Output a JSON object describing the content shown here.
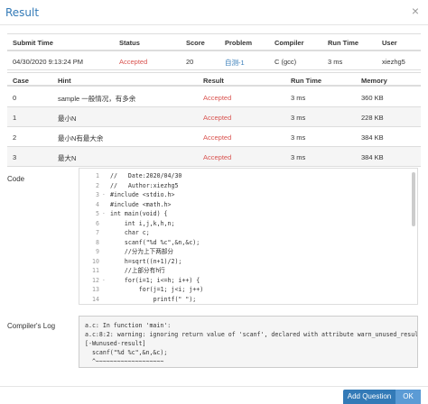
{
  "dialog": {
    "title": "Result",
    "close_glyph": "×"
  },
  "summary": {
    "headers": [
      "Submit Time",
      "Status",
      "Score",
      "Problem",
      "Compiler",
      "Run Time",
      "User"
    ],
    "row": {
      "submit_time": "04/30/2020 9:13:24 PM",
      "status": "Accepted",
      "score": "20",
      "problem": "自测-1",
      "compiler": "C (gcc)",
      "run_time": "3 ms",
      "user": "xiezhg5"
    }
  },
  "cases": {
    "headers": [
      "Case",
      "Hint",
      "Result",
      "Run Time",
      "Memory"
    ],
    "rows": [
      {
        "case": "0",
        "hint": "sample 一般情况，有多余",
        "result": "Accepted",
        "run_time": "3 ms",
        "memory": "360 KB"
      },
      {
        "case": "1",
        "hint": "最小N",
        "result": "Accepted",
        "run_time": "3 ms",
        "memory": "228 KB"
      },
      {
        "case": "2",
        "hint": "最小N有最大余",
        "result": "Accepted",
        "run_time": "3 ms",
        "memory": "384 KB"
      },
      {
        "case": "3",
        "hint": "最大N",
        "result": "Accepted",
        "run_time": "3 ms",
        "memory": "384 KB"
      }
    ]
  },
  "code": {
    "label": "Code",
    "lines": [
      {
        "n": "1",
        "fold": "",
        "text": "//   Date:2020/04/30"
      },
      {
        "n": "2",
        "fold": "",
        "text": "//   Author:xiezhg5"
      },
      {
        "n": "3",
        "fold": "-",
        "text": "#include <stdio.h>"
      },
      {
        "n": "4",
        "fold": "",
        "text": "#include <math.h>"
      },
      {
        "n": "5",
        "fold": "-",
        "text": "int main(void) {"
      },
      {
        "n": "6",
        "fold": "",
        "text": "    int i,j,k,h,n;"
      },
      {
        "n": "7",
        "fold": "",
        "text": "    char c;"
      },
      {
        "n": "8",
        "fold": "",
        "text": "    scanf(\"%d %c\",&n,&c);"
      },
      {
        "n": "9",
        "fold": "",
        "text": "    //分为上下两部分"
      },
      {
        "n": "10",
        "fold": "",
        "text": "    h=sqrt((n+1)/2);"
      },
      {
        "n": "11",
        "fold": "",
        "text": "    //上部分有h行"
      },
      {
        "n": "12",
        "fold": "-",
        "text": "    for(i=1; i<=h; i++) {"
      },
      {
        "n": "13",
        "fold": "",
        "text": "        for(j=1; j<i; j++)"
      },
      {
        "n": "14",
        "fold": "",
        "text": "            printf(\" \");"
      },
      {
        "n": "15",
        "fold": "-",
        "text": "        for(k=1; k<=2*(h-i+1)-1; k++)"
      }
    ]
  },
  "log": {
    "label": "Compiler's Log",
    "lines": [
      "a.c: In function 'main':",
      "a.c:8:2: warning: ignoring return value of 'scanf', declared with attribute warn_unused_result",
      "[-Wunused-result]",
      "  scanf(\"%d %c\",&n,&c);",
      "  ^~~~~~~~~~~~~~~~~~~~"
    ]
  },
  "footer": {
    "add_question_label": "Add Question",
    "ok_label": "OK"
  }
}
